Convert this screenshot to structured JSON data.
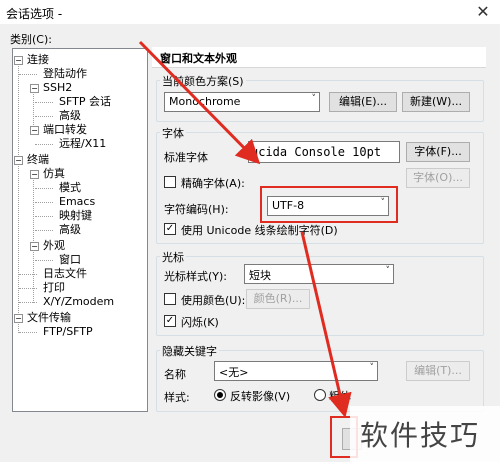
{
  "window": {
    "title": "会话选项 -",
    "close_glyph": "✕"
  },
  "category_label": "类别(C):",
  "tree": [
    {
      "label": "连接",
      "expander": "−"
    },
    {
      "label": "登陆动作",
      "expander": ""
    },
    {
      "label": "SSH2",
      "expander": "−"
    },
    {
      "label": "SFTP 会话",
      "expander": ""
    },
    {
      "label": "高级",
      "expander": ""
    },
    {
      "label": "端口转发",
      "expander": "−"
    },
    {
      "label": "远程/X11",
      "expander": ""
    },
    {
      "label": "终端",
      "expander": "−"
    },
    {
      "label": "仿真",
      "expander": "−"
    },
    {
      "label": "模式",
      "expander": ""
    },
    {
      "label": "Emacs",
      "expander": ""
    },
    {
      "label": "映射键",
      "expander": ""
    },
    {
      "label": "高级",
      "expander": ""
    },
    {
      "label": "外观",
      "expander": "−"
    },
    {
      "label": "窗口",
      "expander": ""
    },
    {
      "label": "日志文件",
      "expander": ""
    },
    {
      "label": "打印",
      "expander": ""
    },
    {
      "label": "X/Y/Zmodem",
      "expander": ""
    },
    {
      "label": "文件传输",
      "expander": "−"
    },
    {
      "label": "FTP/SFTP",
      "expander": ""
    }
  ],
  "panel_title": "窗口和文本外观",
  "color_scheme": {
    "group_label": "当前颜色方案(S)",
    "value": "Monochrome",
    "edit_button": "编辑(E)...",
    "new_button": "新建(W)..."
  },
  "font": {
    "group_label": "字体",
    "standard_label": "标准字体",
    "standard_value": "ucida Console 10pt",
    "font_button": "字体(F)...",
    "precise_label": "精确字体(A):",
    "precise_checked": false,
    "precise_button": "字体(O)...",
    "encoding_label": "字符编码(H):",
    "encoding_value": "UTF-8",
    "unicode_label": "使用 Unicode 线条绘制字符(D)",
    "unicode_checked": true
  },
  "cursor": {
    "group_label": "光标",
    "style_label": "光标样式(Y):",
    "style_value": "短块",
    "use_color_label": "使用颜色(U):",
    "use_color_checked": false,
    "color_button": "颜色(R)...",
    "blink_label": "闪烁(K)",
    "blink_checked": true
  },
  "keywords": {
    "group_label": "隐藏关键字",
    "name_label": "名称",
    "name_value": "<无>",
    "edit_button": "编辑(T)...",
    "style_label": "样式:",
    "reverse_label": "反转影像(V)",
    "reverse_selected": true,
    "bold_label": "粗体"
  },
  "watermark": "软件技巧",
  "colors": {
    "annotation_red": "#e02b20",
    "dropdown_arrow": "˅",
    "checkmark": "✓"
  }
}
